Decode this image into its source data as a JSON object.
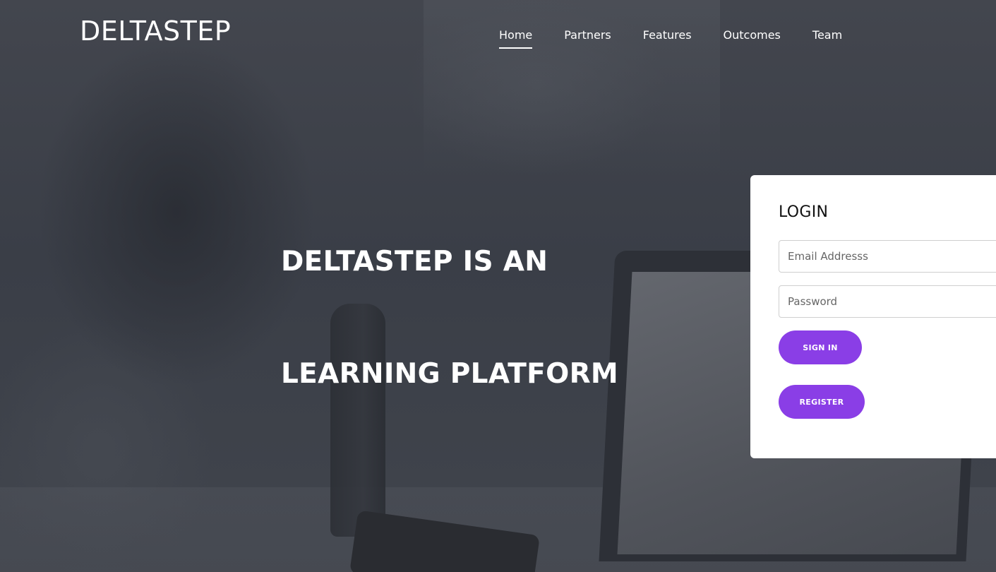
{
  "brand": {
    "name": "DELTASTEP"
  },
  "nav": {
    "items": [
      {
        "label": "Home",
        "active": true
      },
      {
        "label": "Partners",
        "active": false
      },
      {
        "label": "Features",
        "active": false
      },
      {
        "label": "Outcomes",
        "active": false
      },
      {
        "label": "Team",
        "active": false
      }
    ]
  },
  "hero": {
    "line1": "DELTASTEP IS AN",
    "line2": "LEARNING PLATFORM"
  },
  "login": {
    "title": "LOGIN",
    "email_placeholder": "Email Addresss",
    "password_placeholder": "Password",
    "signin_label": "SIGN IN",
    "register_label": "REGISTER"
  },
  "colors": {
    "accent": "#8a3ee6",
    "overlay": "#3b3f48",
    "text": "#ffffff"
  }
}
